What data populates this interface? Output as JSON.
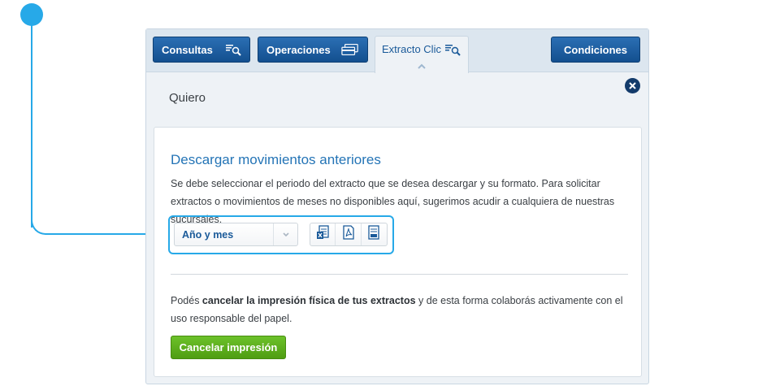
{
  "tabs": {
    "consultas_label": "Consultas",
    "operaciones_label": "Operaciones",
    "extracto_label": "Extracto Clic",
    "condiciones_label": "Condiciones"
  },
  "panel": {
    "heading": "Quiero"
  },
  "card": {
    "title": "Descargar movimientos anteriores",
    "description": "Se debe seleccionar el periodo del extracto que se desea descargar y su formato. Para solicitar extractos o movimientos de meses no disponibles aquí, sugerimos acudir a cualquiera de nuestras sucursales.",
    "select_value": "Año y mes",
    "info_prefix": "Podés ",
    "info_bold": "cancelar la impresión física de tus extractos",
    "info_suffix": " y de esta forma colaborás activamente con el uso responsable del papel.",
    "cancel_button_label": "Cancelar impresión"
  },
  "icons": {
    "consultas": "document-search-icon",
    "operaciones": "transfer-cards-icon",
    "extracto": "document-search-icon",
    "download_formats": [
      "excel-file-icon",
      "pdf-file-icon",
      "text-file-icon"
    ]
  },
  "colors": {
    "primary_blue": "#1a5a99",
    "callout": "#27a9e8",
    "green_button": "#5aae1a"
  }
}
